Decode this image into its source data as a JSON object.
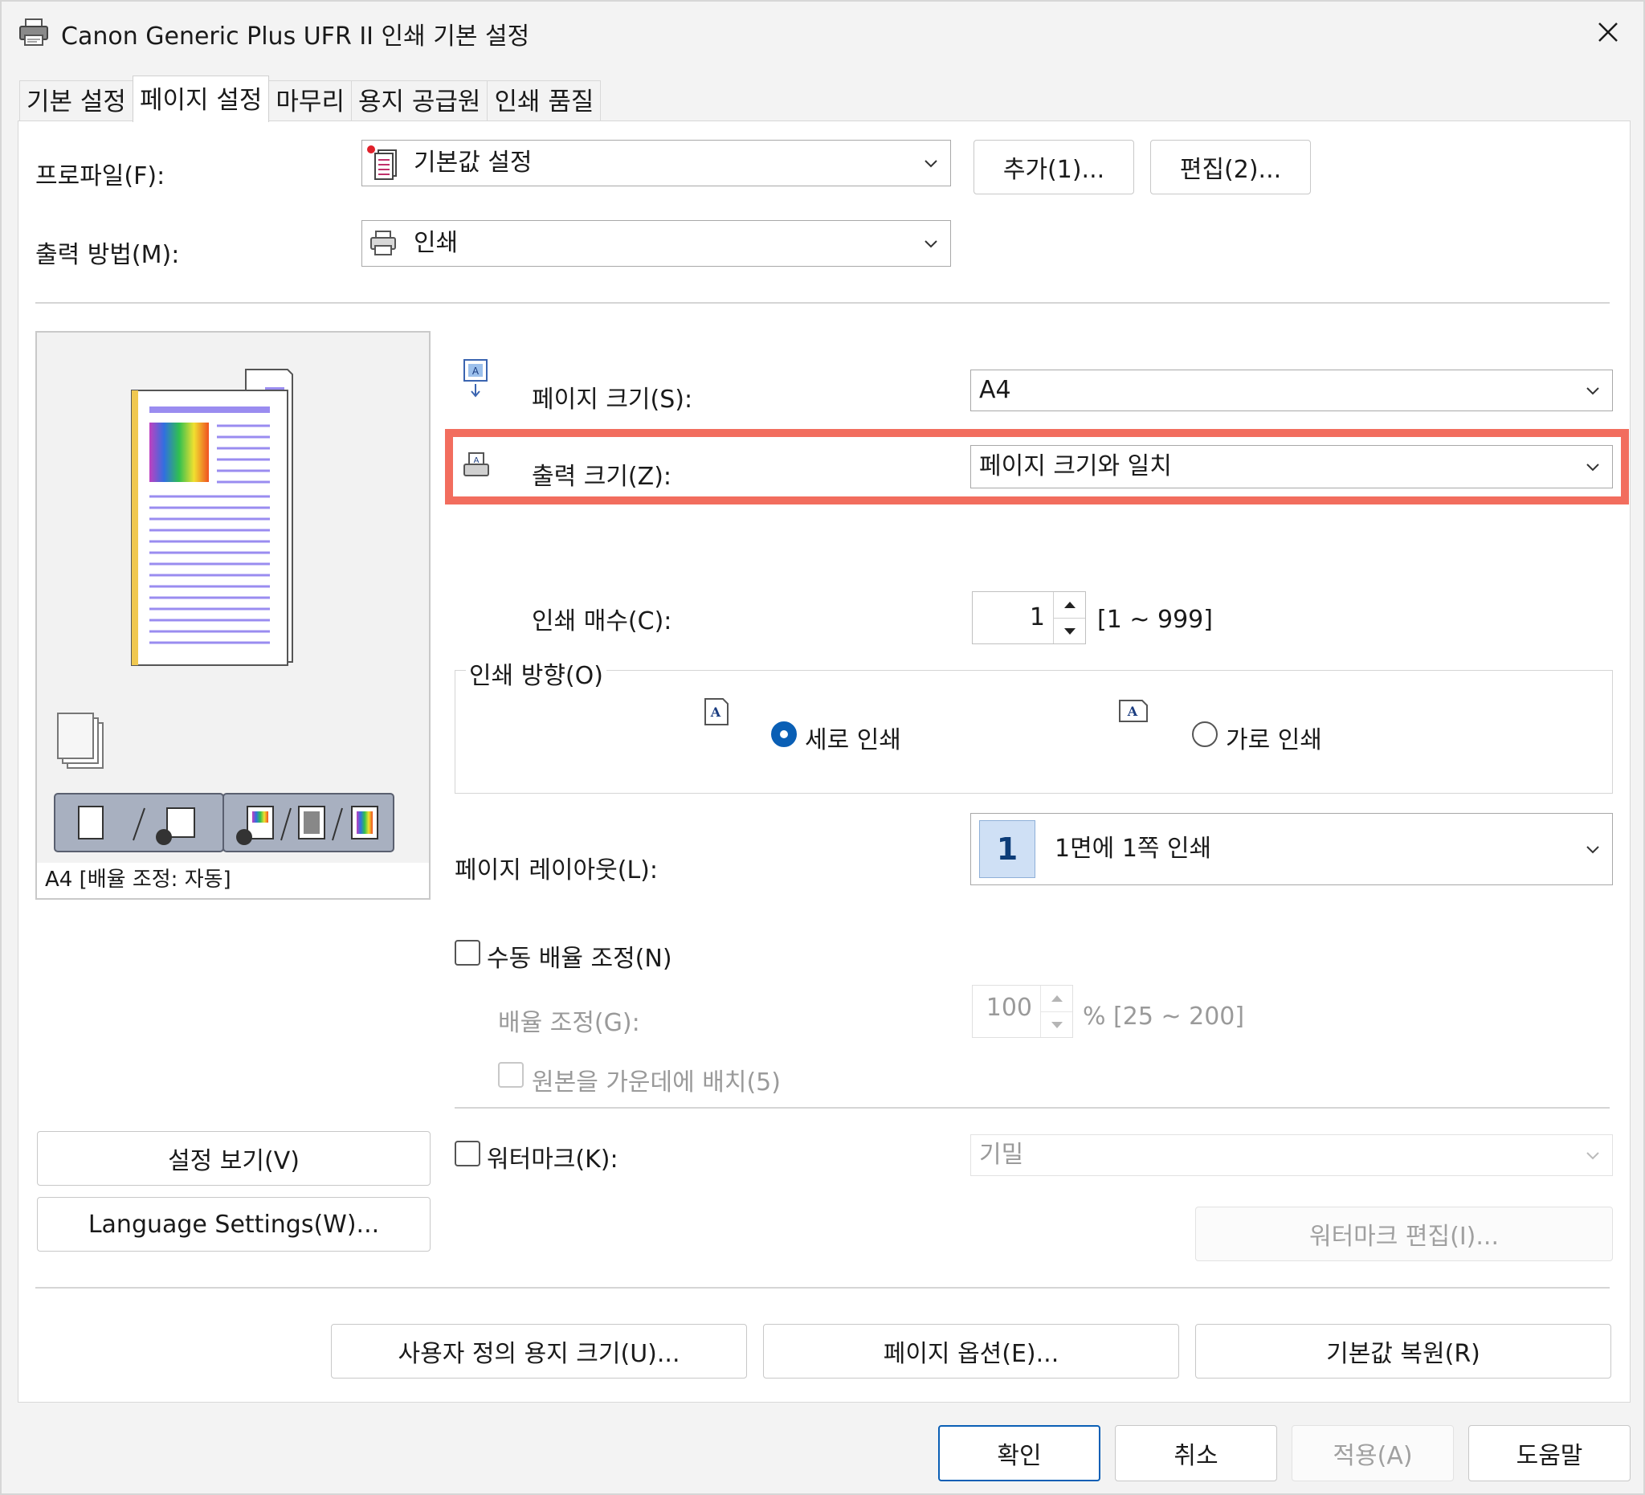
{
  "window": {
    "title": "Canon Generic Plus UFR II 인쇄 기본 설정",
    "close_glyph": "✕"
  },
  "tabs": [
    {
      "label": "기본 설정"
    },
    {
      "label": "페이지 설정"
    },
    {
      "label": "마무리"
    },
    {
      "label": "용지 공급원"
    },
    {
      "label": "인쇄 품질"
    }
  ],
  "profile": {
    "label": "프로파일(F):",
    "value": "기본값 설정",
    "add_button": "추가(1)...",
    "edit_button": "편집(2)..."
  },
  "output_method": {
    "label": "출력 방법(M):",
    "value": "인쇄"
  },
  "page_size": {
    "label": "페이지 크기(S):",
    "value": "A4"
  },
  "output_size": {
    "label": "출력 크기(Z):",
    "value": "페이지 크기와 일치"
  },
  "copies": {
    "label": "인쇄 매수(C):",
    "value": "1",
    "range": "[1 ~ 999]"
  },
  "orientation": {
    "group_label": "인쇄 방향(O)",
    "icon_letter": "A",
    "portrait": "세로 인쇄",
    "landscape": "가로 인쇄",
    "selected": "portrait"
  },
  "page_layout": {
    "label": "페이지 레이아웃(L):",
    "badge": "1",
    "value": "1면에 1쪽 인쇄"
  },
  "manual_scaling": {
    "label": "수동 배율 조정(N)",
    "checked": false,
    "scale_label": "배율 조정(G):",
    "scale_value": "100",
    "scale_range": "% [25 ~ 200]",
    "center_label": "원본을 가운데에 배치(5)"
  },
  "watermark": {
    "label": "워터마크(K):",
    "checked": false,
    "value": "기밀",
    "edit_button": "워터마크 편집(I)..."
  },
  "preview": {
    "caption": "A4 [배율 조정: 자동]"
  },
  "left_buttons": {
    "view_settings": "설정 보기(V)",
    "language_settings": "Language Settings(W)..."
  },
  "bottom_buttons": {
    "custom_paper": "사용자 정의 용지 크기(U)...",
    "page_options": "페이지 옵션(E)...",
    "restore_defaults": "기본값 복원(R)"
  },
  "dialog_buttons": {
    "ok": "확인",
    "cancel": "취소",
    "apply": "적용(A)",
    "help": "도움말"
  },
  "colors": {
    "highlight": "#f26d5e",
    "accent": "#0a5fb5"
  }
}
